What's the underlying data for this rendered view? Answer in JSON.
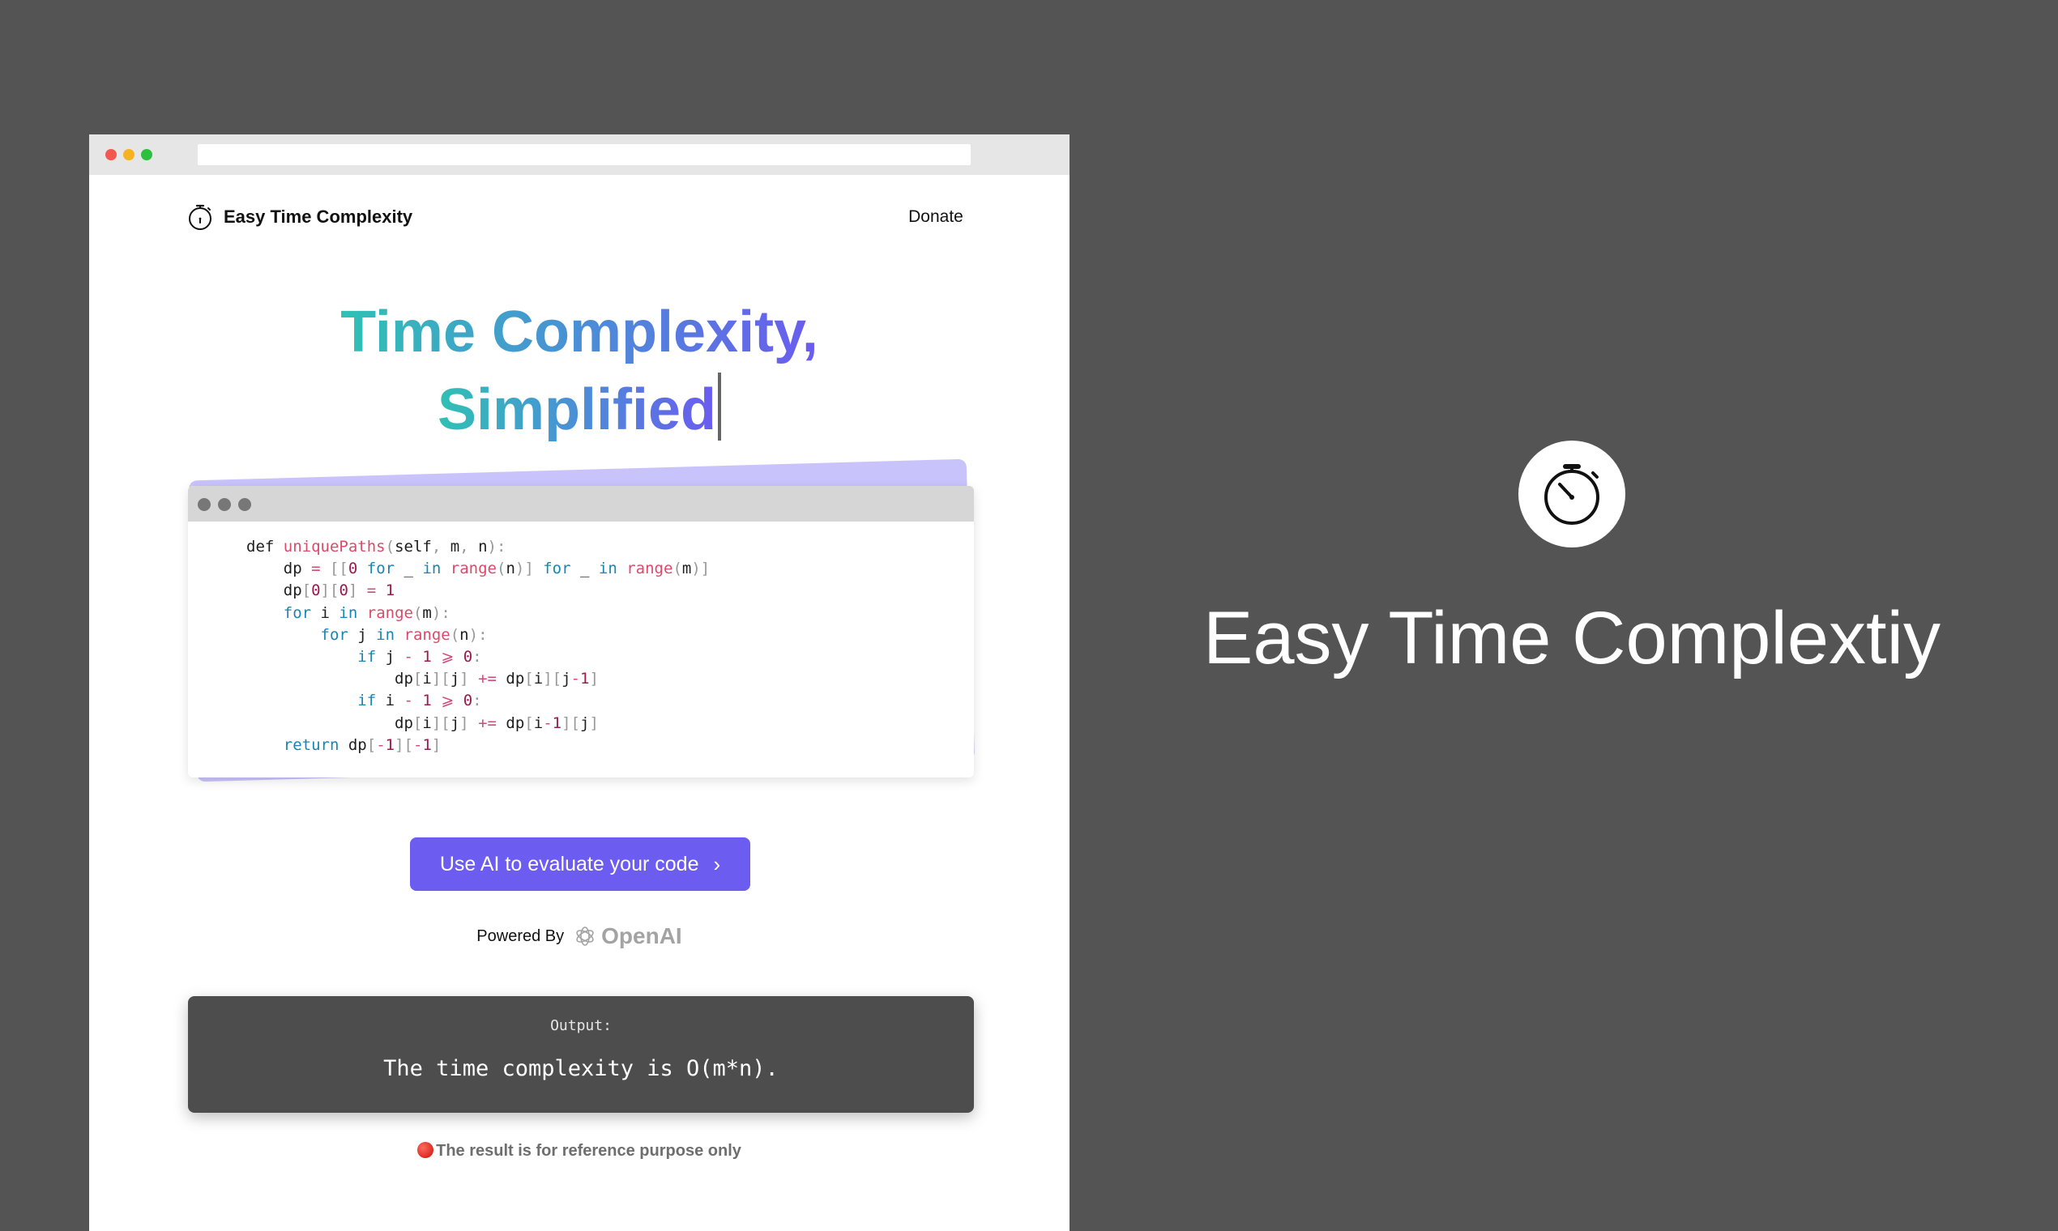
{
  "site": {
    "brand": "Easy Time Complexity",
    "donate_label": "Donate"
  },
  "hero": {
    "line1": "Time Complexity,",
    "line2": "Simplified"
  },
  "code": {
    "function_name": "uniquePaths"
  },
  "cta": {
    "label": "Use AI to evaluate your code",
    "icon": "chevron-right-icon"
  },
  "powered_by": {
    "label": "Powered By",
    "provider": "OpenAI"
  },
  "output": {
    "label": "Output:",
    "text": "The time complexity is O(m*n)."
  },
  "disclaimer": "The result is for reference purpose only",
  "branding": {
    "title": "Easy Time Complextiy",
    "icon": "stopwatch-icon"
  },
  "colors": {
    "background": "#545454",
    "accent": "#6c5cf0",
    "gradient_start": "#2fc1b4",
    "gradient_end": "#6b5bf0",
    "output_bg": "#4d4d4d"
  }
}
